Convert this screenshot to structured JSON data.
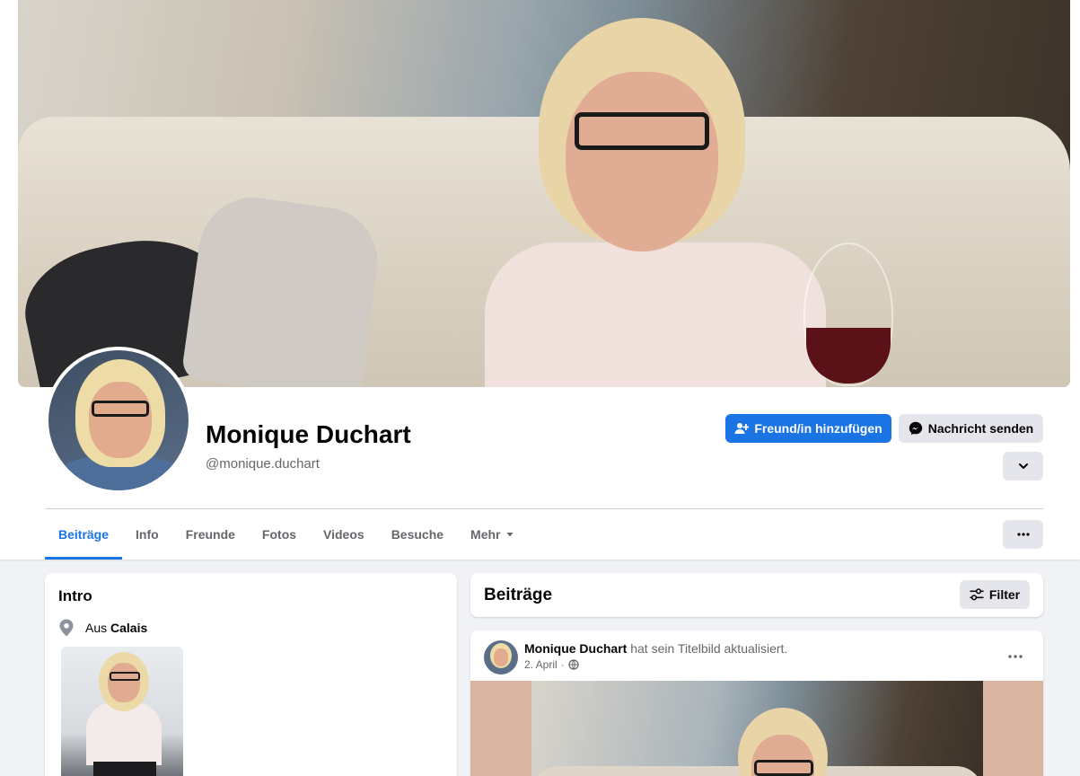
{
  "profile": {
    "name": "Monique Duchart",
    "handle": "@monique.duchart"
  },
  "actions": {
    "add_friend_label": "Freund/in hinzufügen",
    "message_label": "Nachricht senden",
    "add_friend_icon": "person-plus-icon",
    "message_icon": "messenger-icon",
    "chevron_icon": "chevron-down-icon",
    "tabs_more_icon": "ellipsis-icon"
  },
  "tabs": [
    {
      "label": "Beiträge",
      "active": true
    },
    {
      "label": "Info"
    },
    {
      "label": "Freunde"
    },
    {
      "label": "Fotos"
    },
    {
      "label": "Videos"
    },
    {
      "label": "Besuche"
    },
    {
      "label": "Mehr",
      "dropdown": true
    }
  ],
  "intro": {
    "title": "Intro",
    "location_prefix": "Aus",
    "location_city": "Calais",
    "location_icon": "location-pin-icon"
  },
  "posts": {
    "title": "Beiträge",
    "filter_label": "Filter",
    "filter_icon": "sliders-icon",
    "items": [
      {
        "author": "Monique Duchart",
        "action": "hat sein Titelbild aktualisiert.",
        "date": "2. April",
        "separator": "·",
        "audience_icon": "globe-icon"
      }
    ]
  },
  "colors": {
    "primary": "#1b74e4",
    "secondary_button": "#e4e6eb",
    "page_background": "#f0f2f5",
    "muted_text": "#65676b"
  }
}
